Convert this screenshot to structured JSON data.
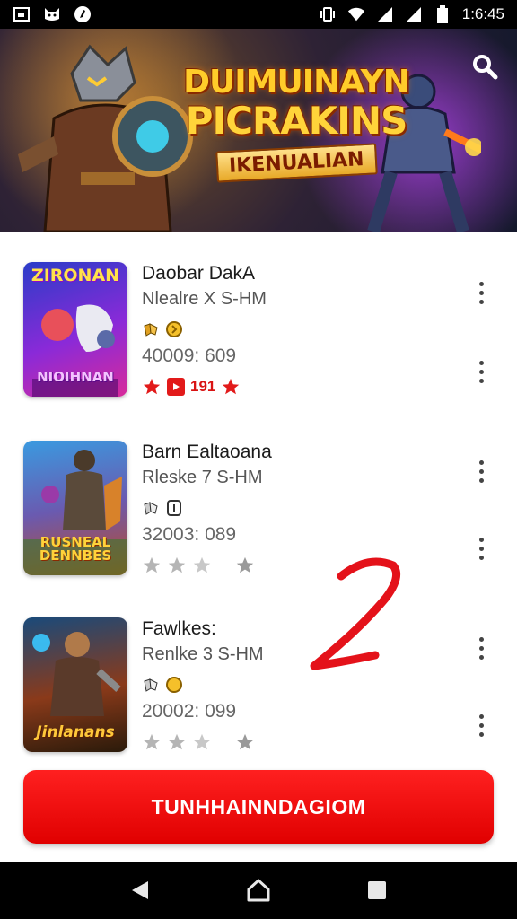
{
  "status_bar": {
    "time": "1:6:45",
    "icons": [
      "image-icon",
      "cat-icon",
      "app-icon",
      "vibrate-icon",
      "wifi-icon",
      "signal-icon",
      "signal-icon-2",
      "battery-icon"
    ]
  },
  "banner": {
    "title_line1": "DUIMUINAYN",
    "title_line2": "PICRAKINS",
    "subtitle": "IKENUALIAN",
    "search_icon": "search-icon"
  },
  "items": [
    {
      "thumb_top": "ZIRONAN",
      "thumb_bottom": "NIOIHNAN",
      "title": "Daobar DakA",
      "subtitle": "Nlealre X S-HM",
      "price": "40009: 609",
      "rating_count": "191",
      "rating_style": "red"
    },
    {
      "thumb_top": "",
      "thumb_bottom": "RUSNEAL DENNBES",
      "title": "Barn Ealtaoana",
      "subtitle": "Rleske 7 S-HM",
      "price": "32003: 089",
      "rating_count": "",
      "rating_style": "grey"
    },
    {
      "thumb_top": "",
      "thumb_bottom": "Jinlanans",
      "title": "Fawlkes:",
      "subtitle": "Renlke 3 S-HM",
      "price": "20002: 099",
      "rating_count": "",
      "rating_style": "grey"
    }
  ],
  "annotation": "2",
  "cta": {
    "label": "TUNHHAINNDAGIOM"
  },
  "colors": {
    "accent": "#e50000",
    "star_red": "#e21a1a",
    "star_grey": "#b5b5b5"
  },
  "nav": {
    "back_icon": "back-icon",
    "home_icon": "home-icon",
    "recents_icon": "recents-icon"
  }
}
